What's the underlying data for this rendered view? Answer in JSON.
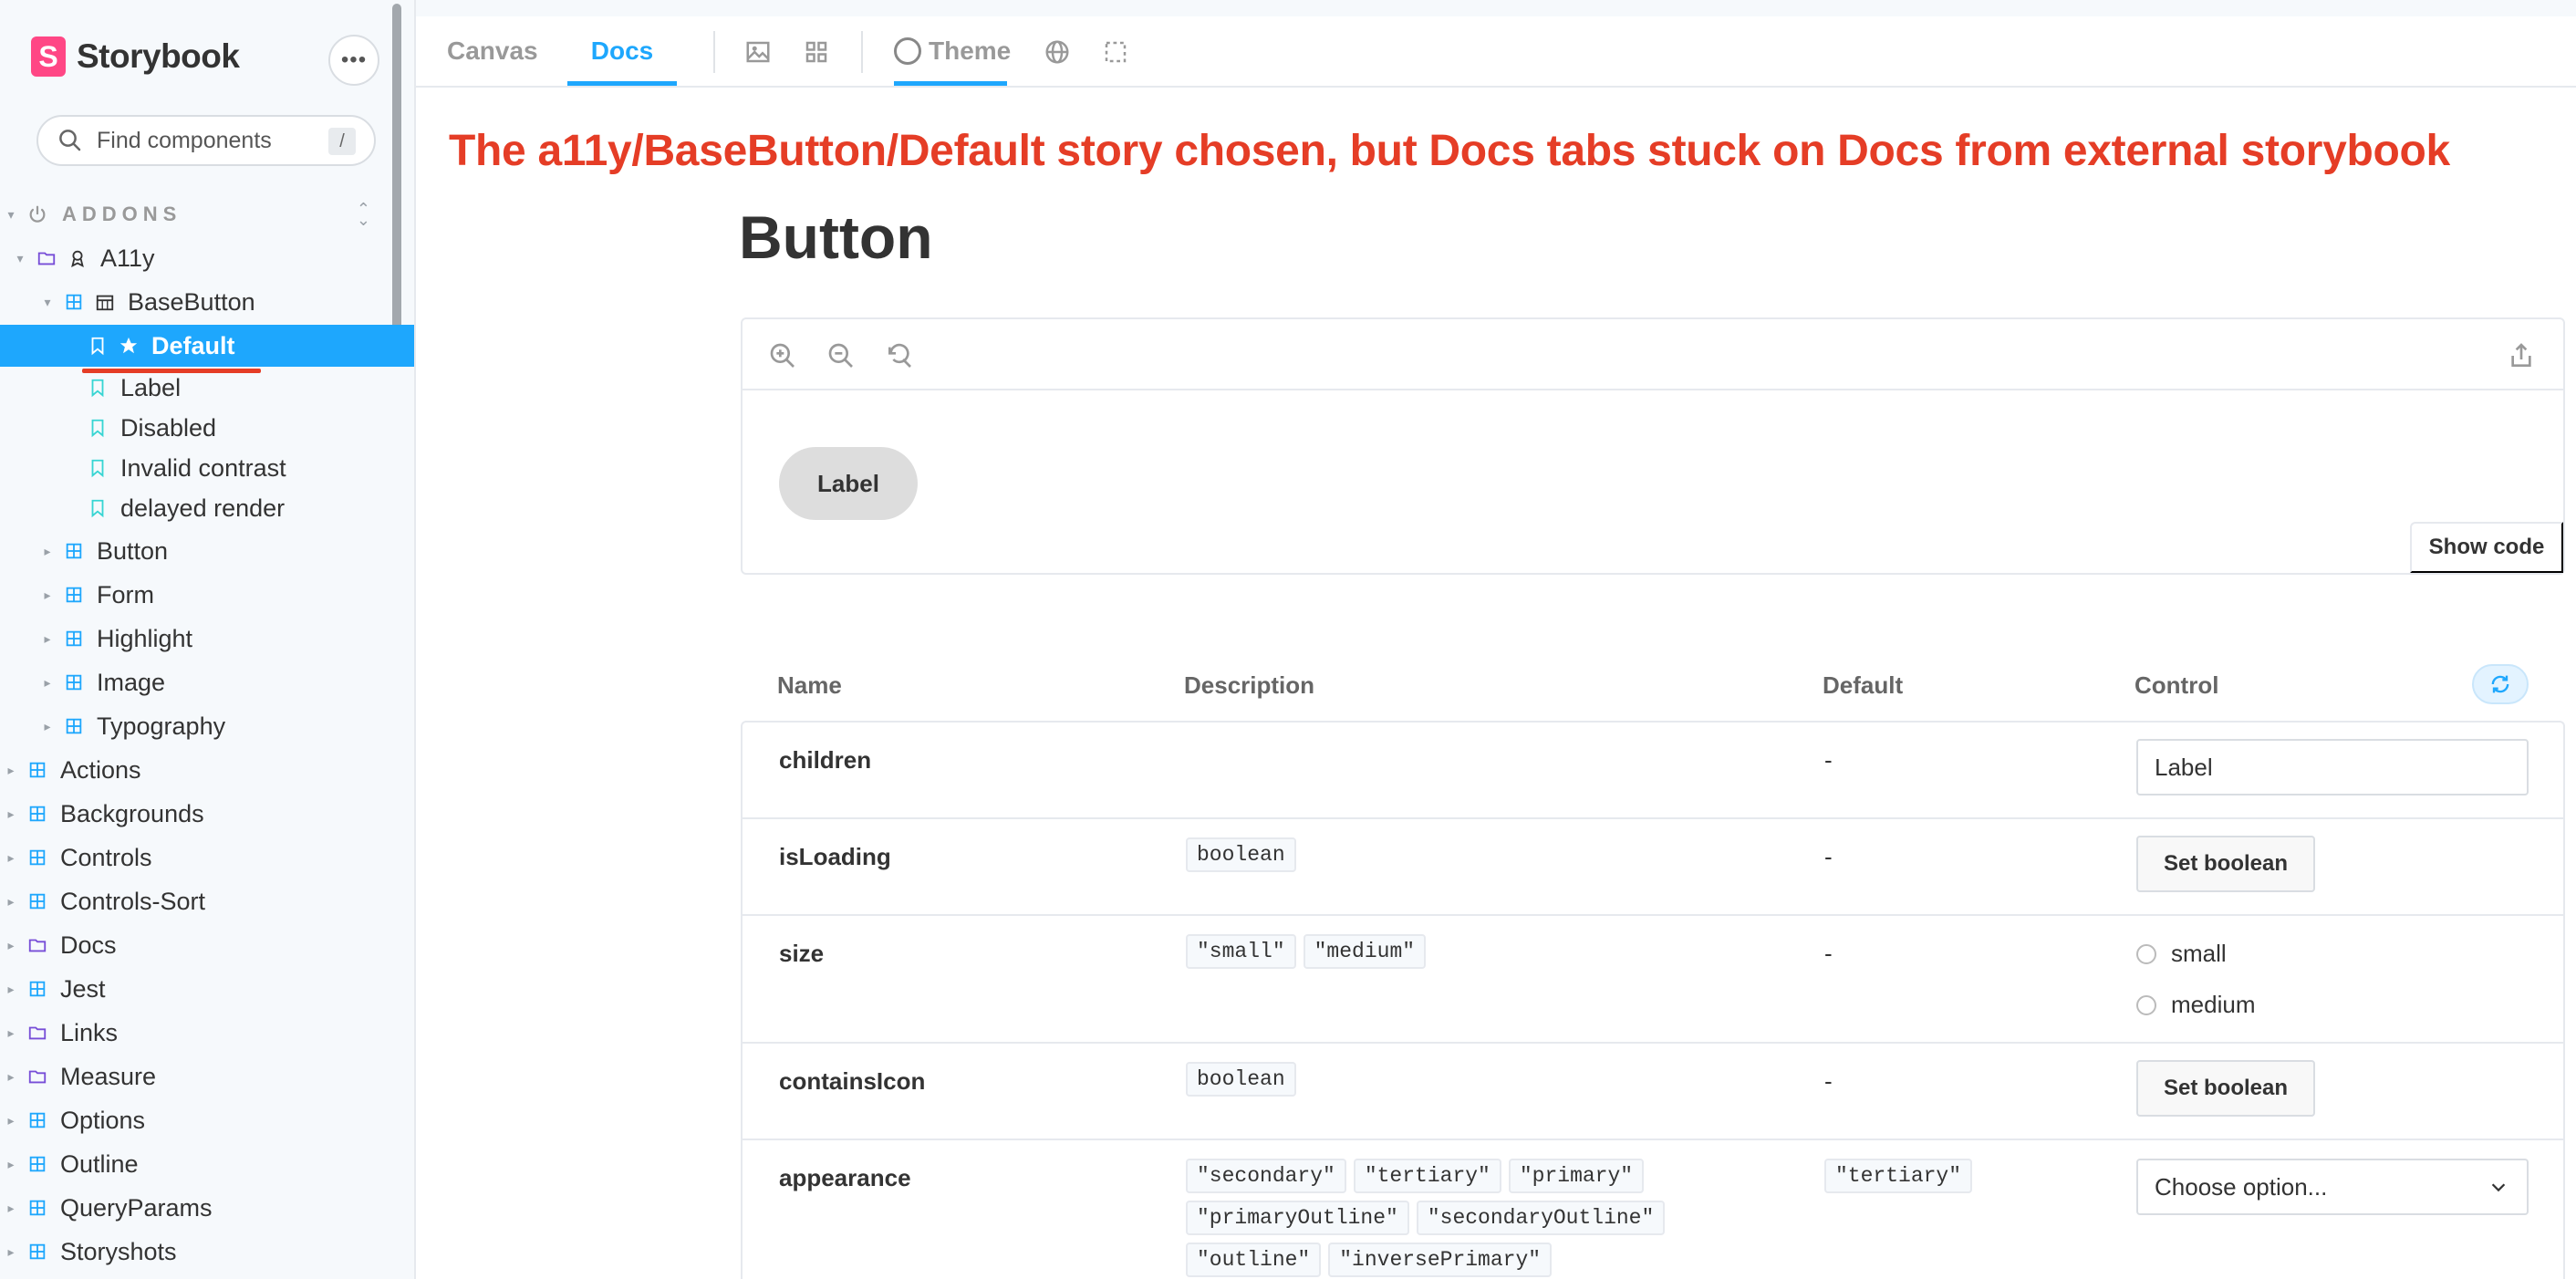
{
  "sidebar": {
    "brand": {
      "logo_letter": "S",
      "name": "Storybook"
    },
    "menu_label": "•••",
    "search": {
      "placeholder": "Find components",
      "shortcut": "/"
    },
    "addons_label": "ADDONS",
    "tree": [
      {
        "label": "A11y",
        "icon": "folder-icon"
      },
      {
        "label": "BaseButton",
        "icon": "component-icon"
      },
      {
        "label": "Default",
        "icon": "bookmark-icon",
        "selected": true
      },
      {
        "label": "Label",
        "icon": "bookmark-icon"
      },
      {
        "label": "Disabled",
        "icon": "bookmark-icon"
      },
      {
        "label": "Invalid contrast",
        "icon": "bookmark-icon"
      },
      {
        "label": "delayed render",
        "icon": "bookmark-icon"
      },
      {
        "label": "Button",
        "icon": "component-icon"
      },
      {
        "label": "Form",
        "icon": "component-icon"
      },
      {
        "label": "Highlight",
        "icon": "component-icon"
      },
      {
        "label": "Image",
        "icon": "component-icon"
      },
      {
        "label": "Typography",
        "icon": "component-icon"
      },
      {
        "label": "Actions",
        "icon": "component-icon"
      },
      {
        "label": "Backgrounds",
        "icon": "component-icon"
      },
      {
        "label": "Controls",
        "icon": "component-icon"
      },
      {
        "label": "Controls-Sort",
        "icon": "component-icon"
      },
      {
        "label": "Docs",
        "icon": "folder-icon"
      },
      {
        "label": "Jest",
        "icon": "component-icon"
      },
      {
        "label": "Links",
        "icon": "folder-icon"
      },
      {
        "label": "Measure",
        "icon": "folder-icon"
      },
      {
        "label": "Options",
        "icon": "component-icon"
      },
      {
        "label": "Outline",
        "icon": "component-icon"
      },
      {
        "label": "QueryParams",
        "icon": "component-icon"
      },
      {
        "label": "Storyshots",
        "icon": "component-icon"
      }
    ]
  },
  "toolbar": {
    "tabs": [
      {
        "label": "Canvas",
        "active": false
      },
      {
        "label": "Docs",
        "active": true
      }
    ],
    "theme_label": "Theme"
  },
  "annotation": "The a11y/BaseButton/Default story chosen, but Docs tabs stuck on Docs from external storybook",
  "doc": {
    "title": "Button",
    "preview": {
      "button_label": "Label",
      "show_code": "Show code"
    },
    "props": {
      "headers": {
        "name": "Name",
        "description": "Description",
        "default": "Default",
        "control": "Control"
      },
      "rows": [
        {
          "name": "children",
          "types": [],
          "default": "-",
          "control_value": "Label"
        },
        {
          "name": "isLoading",
          "types": [
            "boolean"
          ],
          "default": "-",
          "control_label": "Set boolean"
        },
        {
          "name": "size",
          "types": [
            "\"small\"",
            "\"medium\""
          ],
          "default": "-",
          "options": [
            "small",
            "medium"
          ]
        },
        {
          "name": "containsIcon",
          "types": [
            "boolean"
          ],
          "default": "-",
          "control_label": "Set boolean"
        },
        {
          "name": "appearance",
          "types": [
            "\"secondary\"",
            "\"tertiary\"",
            "\"primary\"",
            "\"primaryOutline\"",
            "\"secondaryOutline\"",
            "\"outline\"",
            "\"inversePrimary\""
          ],
          "default": "\"tertiary\"",
          "control_placeholder": "Choose option..."
        }
      ]
    }
  },
  "colors": {
    "accent": "#1ea7fd",
    "annotation": "#e53d26",
    "brand": "#ff4785",
    "sidebar_bg": "#f6f9fc"
  }
}
